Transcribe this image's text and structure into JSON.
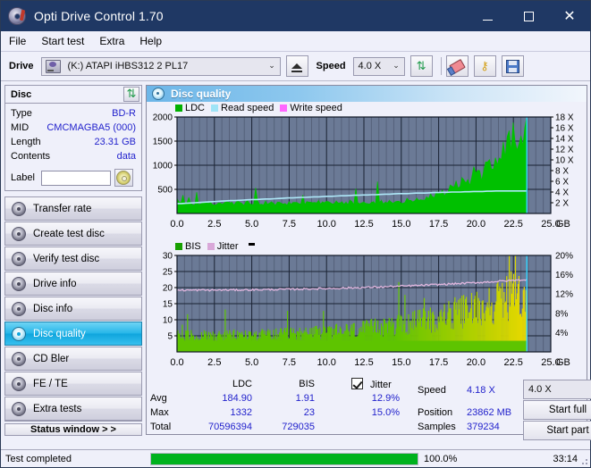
{
  "window": {
    "title": "Opti Drive Control 1.70",
    "icon": "disc-icon",
    "minimize": "–",
    "maximize": "▢",
    "close": "✕"
  },
  "menu": {
    "items": [
      {
        "label": "File",
        "name": "menu-file"
      },
      {
        "label": "Start test",
        "name": "menu-start-test"
      },
      {
        "label": "Extra",
        "name": "menu-extra"
      },
      {
        "label": "Help",
        "name": "menu-help"
      }
    ]
  },
  "toolbar": {
    "drive_label": "Drive",
    "drive_value": "(K:)  ATAPI iHBS312  2 PL17",
    "eject_title": "eject-icon",
    "speed_label": "Speed",
    "speed_value": "4.0 X",
    "refresh_icon": "⇅",
    "erase_icon": "eraser-icon",
    "key_icon": "🔑",
    "save_icon": "save-icon"
  },
  "disc": {
    "header": "Disc",
    "refresh_icon": "⇅",
    "rows": [
      {
        "key": "Type",
        "value": "BD-R"
      },
      {
        "key": "MID",
        "value": "CMCMAGBA5 (000)"
      },
      {
        "key": "Length",
        "value": "23.31 GB"
      },
      {
        "key": "Contents",
        "value": "data"
      }
    ],
    "label_key": "Label",
    "label_value": "",
    "label_placeholder": ""
  },
  "nav": {
    "items": [
      {
        "label": "Transfer rate",
        "name": "sidebar-item-transfer-rate",
        "active": false
      },
      {
        "label": "Create test disc",
        "name": "sidebar-item-create-test-disc",
        "active": false
      },
      {
        "label": "Verify test disc",
        "name": "sidebar-item-verify-test-disc",
        "active": false
      },
      {
        "label": "Drive info",
        "name": "sidebar-item-drive-info",
        "active": false
      },
      {
        "label": "Disc info",
        "name": "sidebar-item-disc-info",
        "active": false
      },
      {
        "label": "Disc quality",
        "name": "sidebar-item-disc-quality",
        "active": true
      },
      {
        "label": "CD Bler",
        "name": "sidebar-item-cd-bler",
        "active": false
      },
      {
        "label": "FE / TE",
        "name": "sidebar-item-fe-te",
        "active": false
      },
      {
        "label": "Extra tests",
        "name": "sidebar-item-extra-tests",
        "active": false
      }
    ],
    "status_window": "Status window > >"
  },
  "panel": {
    "title": "Disc quality"
  },
  "stats": {
    "col_ldc": "LDC",
    "col_bis": "BIS",
    "jitter_label": "Jitter",
    "jitter_checked": true,
    "rows": [
      {
        "name": "Avg",
        "ldc": "184.90",
        "bis": "1.91",
        "jitter": "12.9%"
      },
      {
        "name": "Max",
        "ldc": "1332",
        "bis": "23",
        "jitter": "15.0%"
      },
      {
        "name": "Total",
        "ldc": "70596394",
        "bis": "729035",
        "jitter": ""
      }
    ],
    "speed_key": "Speed",
    "speed_value": "4.18 X",
    "position_key": "Position",
    "position_value": "23862 MB",
    "samples_key": "Samples",
    "samples_value": "379234",
    "speed_select": "4.0 X",
    "start_full": "Start full",
    "start_part": "Start part"
  },
  "statusbar": {
    "text": "Test completed",
    "percent_label": "100.0%",
    "percent_value": 100,
    "time": "33:14"
  },
  "colors": {
    "accent": "#0fa5dd",
    "title_bar": "#1f3864",
    "value_text": "#2222cc",
    "plot_bg": "#6b7a96",
    "ldc_green": "#00c000",
    "bis_green": "#44d400",
    "jitter_pink": "#e8b8e0",
    "read_speed": "#9fe4f7",
    "write_speed": "#ff66ff",
    "progress_green": "#00b21e",
    "bis_yellow": "#e8d800"
  },
  "chart_data": [
    {
      "type": "area",
      "name": "ldc-chart",
      "title": "",
      "xlabel": "GB",
      "ylabel": "",
      "ylim": [
        0,
        2000
      ],
      "y2lim": [
        0,
        18
      ],
      "xlim": [
        0,
        25
      ],
      "xticks": [
        "0.0",
        "2.5",
        "5.0",
        "7.5",
        "10.0",
        "12.5",
        "15.0",
        "17.5",
        "20.0",
        "22.5",
        "25.0"
      ],
      "yticks": [
        "500",
        "1000",
        "1500",
        "2000"
      ],
      "y2ticks": [
        "2 X",
        "4 X",
        "6 X",
        "8 X",
        "10 X",
        "12 X",
        "14 X",
        "16 X",
        "18 X"
      ],
      "y2label": "X",
      "legend": [
        {
          "label": "LDC",
          "color": "#00c000"
        },
        {
          "label": "Read speed",
          "color": "#9fe4f7"
        },
        {
          "label": "Write speed",
          "color": "#ff66ff"
        }
      ],
      "series": [
        {
          "name": "LDC",
          "color": "#00c000",
          "x_end": 23.4,
          "values": [
            260,
            230,
            210,
            200,
            205,
            215,
            380,
            200,
            195,
            190,
            410,
            200,
            195,
            190,
            200,
            195,
            230,
            205,
            200,
            195,
            190,
            205,
            200,
            215,
            195,
            200,
            210,
            200,
            195,
            205,
            200,
            215,
            200,
            195,
            190,
            205,
            215,
            200,
            195,
            210,
            200,
            230,
            205,
            200,
            195,
            210,
            200,
            220,
            205,
            200,
            195,
            215,
            200,
            210,
            205,
            200,
            195,
            220,
            210,
            200,
            205,
            240,
            215,
            200,
            210,
            205,
            200,
            230,
            215,
            205,
            200,
            215,
            225,
            210,
            205,
            200,
            240,
            215,
            210,
            205,
            200,
            230,
            220,
            210,
            205,
            215,
            200,
            225,
            235,
            215,
            210,
            205,
            230,
            220,
            215,
            210,
            240,
            225,
            215,
            210,
            250,
            235,
            220,
            215,
            245,
            230,
            220,
            260,
            240,
            230,
            225,
            245,
            260,
            235,
            240,
            250,
            245,
            270,
            255,
            260,
            280,
            265,
            275,
            290,
            300,
            285,
            310,
            325,
            305,
            340,
            355,
            330,
            370,
            395,
            360,
            420,
            445,
            410,
            470,
            505,
            465,
            540,
            575,
            530,
            610,
            650,
            600,
            690,
            730,
            675,
            760,
            800,
            745,
            830,
            880,
            815,
            900,
            960,
            890,
            1000,
            1050,
            980,
            1120,
            1180,
            1100,
            1250,
            1320,
            1230,
            1400,
            1480,
            1380,
            1560,
            1650,
            1540,
            1730,
            1830,
            1710,
            1900,
            2000
          ]
        },
        {
          "name": "Read speed",
          "color": "#9fe4f7",
          "unit": "X",
          "values": [
            1.85,
            1.85,
            1.9,
            1.95,
            2.0,
            2.05,
            2.1,
            2.15,
            2.2,
            2.25,
            2.3,
            2.35,
            2.4,
            2.4,
            2.45,
            2.5,
            2.55,
            2.6,
            2.6,
            2.65,
            2.7,
            2.7,
            2.75,
            2.8,
            2.85,
            2.9,
            2.9,
            2.95,
            3.0,
            3.0,
            3.05,
            3.1,
            3.1,
            3.15,
            3.2,
            3.2,
            3.25,
            3.3,
            3.3,
            3.35,
            3.4,
            3.4,
            3.45,
            3.45,
            3.5,
            3.5,
            3.55,
            3.6,
            3.6,
            3.65,
            3.7,
            3.7,
            3.7,
            3.75,
            3.8,
            3.8,
            3.8,
            3.85,
            3.9,
            3.9,
            3.95,
            3.95,
            4.0,
            4.0,
            4.0,
            4.05,
            4.05,
            4.1,
            4.1,
            4.1,
            4.15,
            4.15,
            4.2,
            4.2,
            4.2,
            4.2,
            4.2,
            4.2,
            4.2,
            4.2
          ]
        }
      ],
      "cursor_x": 23.4
    },
    {
      "type": "area",
      "name": "bis-jitter-chart",
      "title": "",
      "xlabel": "GB",
      "ylim": [
        0,
        30
      ],
      "y2lim": [
        0,
        20
      ],
      "xlim": [
        0,
        25
      ],
      "xticks": [
        "0.0",
        "2.5",
        "5.0",
        "7.5",
        "10.0",
        "12.5",
        "15.0",
        "17.5",
        "20.0",
        "22.5",
        "25.0"
      ],
      "yticks": [
        "5",
        "10",
        "15",
        "20",
        "25",
        "30"
      ],
      "y2ticks": [
        "4%",
        "8%",
        "12%",
        "16%",
        "20%"
      ],
      "legend": [
        {
          "label": "BIS",
          "color": "#3ab800"
        },
        {
          "label": "Jitter",
          "color": "#d9a8d9"
        }
      ],
      "series": [
        {
          "name": "BIS",
          "color_low": "#5ec400",
          "color_high": "#e8d800",
          "avg": 1.91,
          "max": 23,
          "total": 729035
        },
        {
          "name": "Jitter",
          "color": "#d9a8d9",
          "avg_pct": 12.9,
          "max_pct": 15.0,
          "baseline": 19.2,
          "end": 22.5
        }
      ],
      "cursor_x": 23.4
    }
  ]
}
